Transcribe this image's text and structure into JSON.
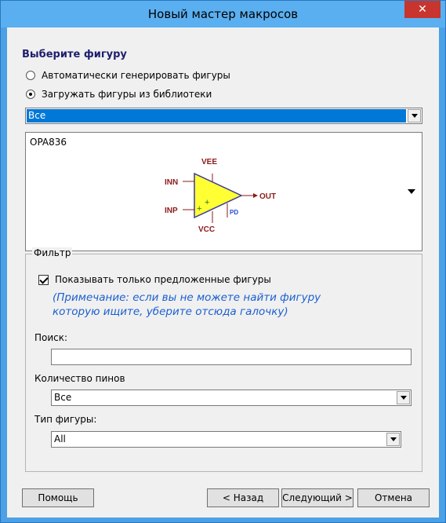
{
  "window": {
    "title": "Новый мастер макросов",
    "close": "✕"
  },
  "heading": "Выберите фигуру",
  "radios": [
    {
      "label": "Автоматически генерировать фигуры",
      "checked": false
    },
    {
      "label": "Загружать фигуры из библиотеки",
      "checked": true
    }
  ],
  "library_combo": {
    "value": "Все"
  },
  "preview": {
    "part_name": "OPA836",
    "pins": {
      "vee": "VEE",
      "inn": "INN",
      "inp": "INP",
      "out": "OUT",
      "pd": "PD",
      "vcc": "VCC"
    },
    "plus_sign": "+"
  },
  "filter": {
    "group_label": "Фильтр",
    "show_suggested_label": "Показывать только предложенные фигуры",
    "show_suggested_checked": true,
    "note": "(Примечание: если вы не можете найти фигуру которую ищите, уберите отсюда галочку)",
    "search_label": "Поиск:",
    "search_value": "",
    "pin_count_label": "Количество пинов",
    "pin_count_value": "Все",
    "shape_type_label": "Тип фигуры:",
    "shape_type_value": "All"
  },
  "buttons": {
    "help": "Помощь",
    "back": "< Назад",
    "next": "Следующий >",
    "cancel": "Отмена"
  },
  "colors": {
    "title_bar": "#5aaff0",
    "selection": "#0078d7",
    "note_text": "#1a5fd0",
    "opamp_fill": "#ffff33"
  }
}
